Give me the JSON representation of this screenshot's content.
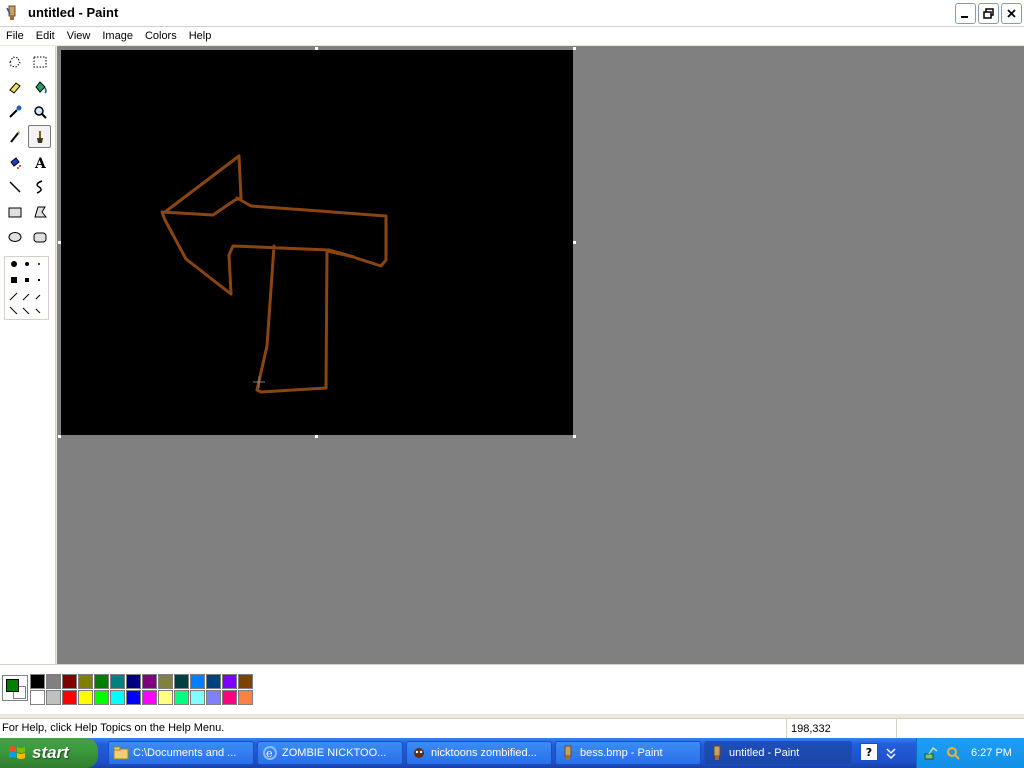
{
  "window": {
    "title": "untitled - Paint"
  },
  "menu": [
    "File",
    "Edit",
    "View",
    "Image",
    "Colors",
    "Help"
  ],
  "tools": [
    {
      "name": "free-form-select",
      "icon": "freeform-select-icon"
    },
    {
      "name": "select",
      "icon": "rect-select-icon"
    },
    {
      "name": "eraser",
      "icon": "eraser-icon"
    },
    {
      "name": "fill",
      "icon": "fill-bucket-icon"
    },
    {
      "name": "pick-color",
      "icon": "eyedropper-icon"
    },
    {
      "name": "magnifier",
      "icon": "magnifier-icon"
    },
    {
      "name": "pencil",
      "icon": "pencil-icon"
    },
    {
      "name": "brush",
      "icon": "brush-icon"
    },
    {
      "name": "airbrush",
      "icon": "airbrush-icon"
    },
    {
      "name": "text",
      "icon": "text-icon"
    },
    {
      "name": "line",
      "icon": "line-icon"
    },
    {
      "name": "curve",
      "icon": "curve-icon"
    },
    {
      "name": "rectangle",
      "icon": "rectangle-icon"
    },
    {
      "name": "polygon",
      "icon": "polygon-icon"
    },
    {
      "name": "ellipse",
      "icon": "ellipse-icon"
    },
    {
      "name": "rounded-rectangle",
      "icon": "rounded-rect-icon"
    }
  ],
  "selected_tool": "brush",
  "canvas": {
    "background": "#000000",
    "stroke_color": "#8b4513"
  },
  "palette": {
    "foreground": "#008000",
    "background": "#ffffff",
    "top_row": [
      "#000000",
      "#808080",
      "#800000",
      "#808000",
      "#008000",
      "#008080",
      "#000080",
      "#800080",
      "#808040",
      "#004040",
      "#0080ff",
      "#004080",
      "#8000ff",
      "#804000"
    ],
    "bottom_row": [
      "#ffffff",
      "#c0c0c0",
      "#ff0000",
      "#ffff00",
      "#00ff00",
      "#00ffff",
      "#0000ff",
      "#ff00ff",
      "#ffff80",
      "#00ff80",
      "#80ffff",
      "#8080ff",
      "#ff0080",
      "#ff8040"
    ]
  },
  "status": {
    "help_text": "For Help, click Help Topics on the Help Menu.",
    "coords": "198,332"
  },
  "taskbar": {
    "start_label": "start",
    "tasks": [
      {
        "label": "C:\\Documents and ...",
        "icon": "folder-icon",
        "active": false
      },
      {
        "label": "ZOMBIE NICKTOO...",
        "icon": "ie-icon",
        "active": false
      },
      {
        "label": "nicktoons zombified...",
        "icon": "app-icon",
        "active": false
      },
      {
        "label": "bess.bmp - Paint",
        "icon": "paint-icon",
        "active": false
      },
      {
        "label": "untitled - Paint",
        "icon": "paint-icon",
        "active": true
      }
    ],
    "clock": "6:27 PM"
  }
}
